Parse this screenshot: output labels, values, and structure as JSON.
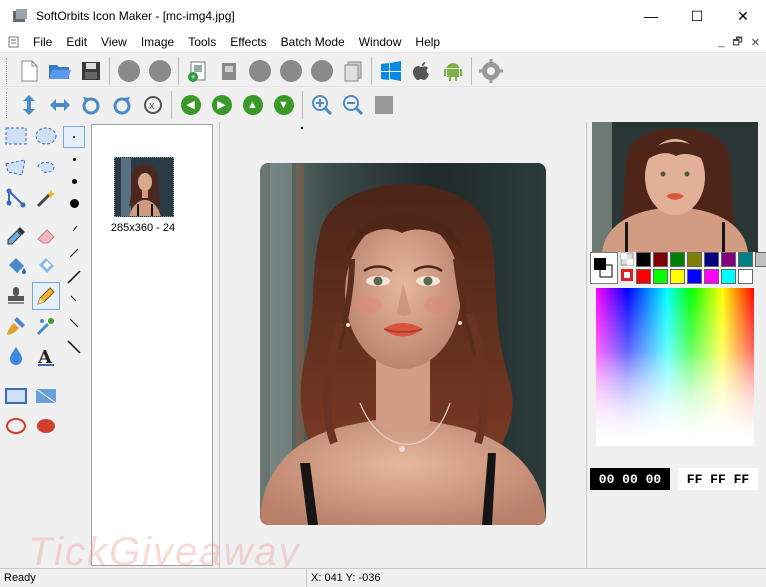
{
  "window": {
    "title": "SoftOrbits Icon Maker - [mc-img4.jpg]",
    "minimize": "—",
    "maximize": "☐",
    "close": "✕"
  },
  "menu": [
    "File",
    "Edit",
    "View",
    "Image",
    "Tools",
    "Effects",
    "Batch Mode",
    "Window",
    "Help"
  ],
  "mdi_controls": [
    "_",
    "🗗",
    "✕"
  ],
  "toolbar1": [
    "new-document",
    "open-folder",
    "save",
    "disabled",
    "disabled",
    "add-image",
    "crop-image",
    "disabled",
    "disabled",
    "disabled",
    "copy-pages",
    "windows-logo",
    "apple-logo",
    "android-logo",
    "settings-gear"
  ],
  "toolbar2": [
    "flip-vertical",
    "flip-horizontal",
    "rotate-left",
    "rotate-right",
    "rotate-custom",
    "back",
    "forward",
    "up",
    "down",
    "zoom-in",
    "zoom-out",
    "fit"
  ],
  "thumbnail": {
    "label": "285x360 - 24"
  },
  "colors": {
    "swatches": [
      "#000000",
      "#800000",
      "#008000",
      "#808000",
      "#000080",
      "#800080",
      "#008080",
      "#c0c0c0",
      "#808080",
      "#ff0000",
      "#00ff00",
      "#ffff00",
      "#0000ff",
      "#ff00ff",
      "#00ffff",
      "#ffffff"
    ],
    "foreground_hex": "00 00 00",
    "background_hex": "FF FF FF"
  },
  "status": {
    "ready": "Ready",
    "coords": "X: 041 Y: -036"
  },
  "watermark": "TickGiveaway"
}
